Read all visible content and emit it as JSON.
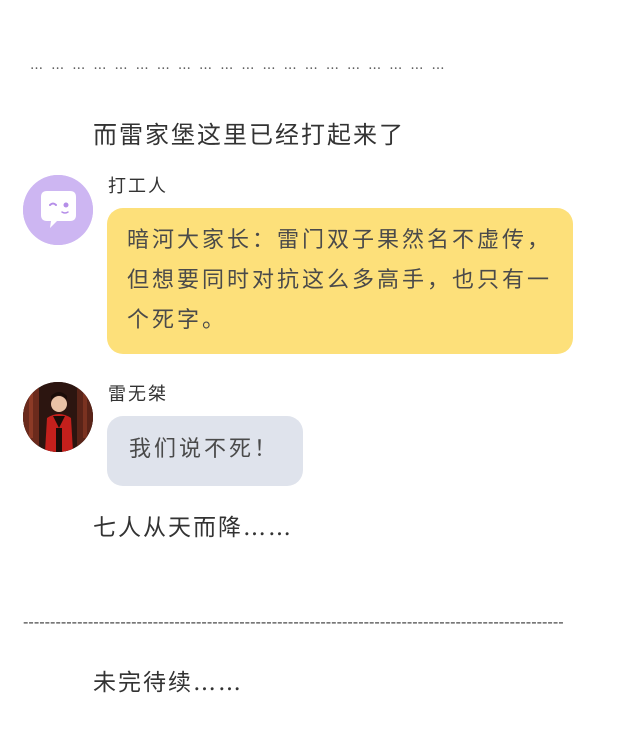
{
  "header": {
    "ellipsis": "…  …  …  …  …  …  …  …  …  …  …  …  …  …  …  …  …  …  …  …"
  },
  "narration": {
    "line1": "而雷家堡这里已经打起来了",
    "line2": "七人从天而降……",
    "line3": "未完待续……"
  },
  "messages": [
    {
      "speaker": "打工人",
      "avatar_icon": "chat-bubble-face-icon",
      "text": "暗河大家长：雷门双子果然名不虚传，但想要同时对抗这么多高手，也只有一个死字。",
      "bubble_color": "#fde07a"
    },
    {
      "speaker": "雷无桀",
      "avatar_icon": "character-photo-avatar",
      "text": "我们说不死！",
      "bubble_color": "#dfe3ec"
    }
  ],
  "divider": {
    "text": "----------------------------------------------------------------------------------------------------"
  },
  "colors": {
    "avatar_purple": "#cdb6f2",
    "yellow_bubble": "#fde07a",
    "gray_bubble": "#dfe3ec"
  }
}
